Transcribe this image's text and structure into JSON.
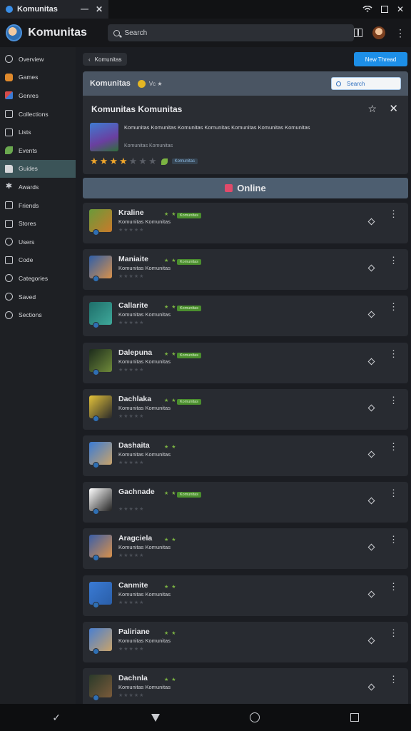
{
  "tab": {
    "label": "Komunitas",
    "minimize": "—",
    "close": "✕"
  },
  "app": {
    "title": "Komunitas"
  },
  "search": {
    "placeholder": "Search"
  },
  "header": {
    "kebab": "⋮"
  },
  "sidebar": {
    "items": [
      {
        "label": "Overview",
        "icon": "clock-icon"
      },
      {
        "label": "Games",
        "icon": "flame-icon"
      },
      {
        "label": "Genres",
        "icon": "cube-icon"
      },
      {
        "label": "Collections",
        "icon": "book-icon"
      },
      {
        "label": "Lists",
        "icon": "list-icon"
      },
      {
        "label": "Events",
        "icon": "leaf-icon"
      },
      {
        "label": "Guides",
        "icon": "folder-icon"
      },
      {
        "label": "Awards",
        "icon": "star-icon"
      },
      {
        "label": "Friends",
        "icon": "grid-icon"
      },
      {
        "label": "Stores",
        "icon": "tag-icon"
      },
      {
        "label": "Users",
        "icon": "user-icon"
      },
      {
        "label": "Code",
        "icon": "code-icon"
      },
      {
        "label": "Categories",
        "icon": "gear-icon"
      },
      {
        "label": "Saved",
        "icon": "bookmark-icon"
      },
      {
        "label": "Sections",
        "icon": "history-icon"
      }
    ]
  },
  "toolbar": {
    "back_label": "Komunitas",
    "primary_label": "New Thread"
  },
  "panel": {
    "title": "Komunitas",
    "sub": "Vc ★",
    "search_placeholder": "Search",
    "detail_title": "Komunitas Komunitas",
    "description": "Komunitas Komunitas Komunitas Komunitas Komunitas Komunitas Komunitas",
    "meta": "Komunitas Komunitas",
    "rating": 4,
    "rating_max": 7,
    "chip": "Komunitas"
  },
  "online": {
    "label": "Online"
  },
  "rows": [
    {
      "name": "Kraline",
      "sub": "Komunitas Komunitas",
      "tag": "Komunitas"
    },
    {
      "name": "Maniaite",
      "sub": "Komunitas Komunitas",
      "tag": "Komunitas"
    },
    {
      "name": "Callarite",
      "sub": "Komunitas Komunitas",
      "tag": "Komunitas"
    },
    {
      "name": "Dalepuna",
      "sub": "Komunitas Komunitas",
      "tag": "Komunitas"
    },
    {
      "name": "Dachlaka",
      "sub": "Komunitas Komunitas",
      "tag": "Komunitas"
    },
    {
      "name": "Dashaita",
      "sub": "Komunitas Komunitas",
      "tag": ""
    },
    {
      "name": "Gachnade",
      "sub": "",
      "tag": "Komunitas"
    },
    {
      "name": "Aragciela",
      "sub": "Komunitas Komunitas",
      "tag": ""
    },
    {
      "name": "Canmite",
      "sub": "Komunitas Komunitas",
      "tag": ""
    },
    {
      "name": "Paliriane",
      "sub": "Komunitas Komunitas",
      "tag": ""
    },
    {
      "name": "Dachnla",
      "sub": "Komunitas Komunitas",
      "tag": ""
    }
  ]
}
